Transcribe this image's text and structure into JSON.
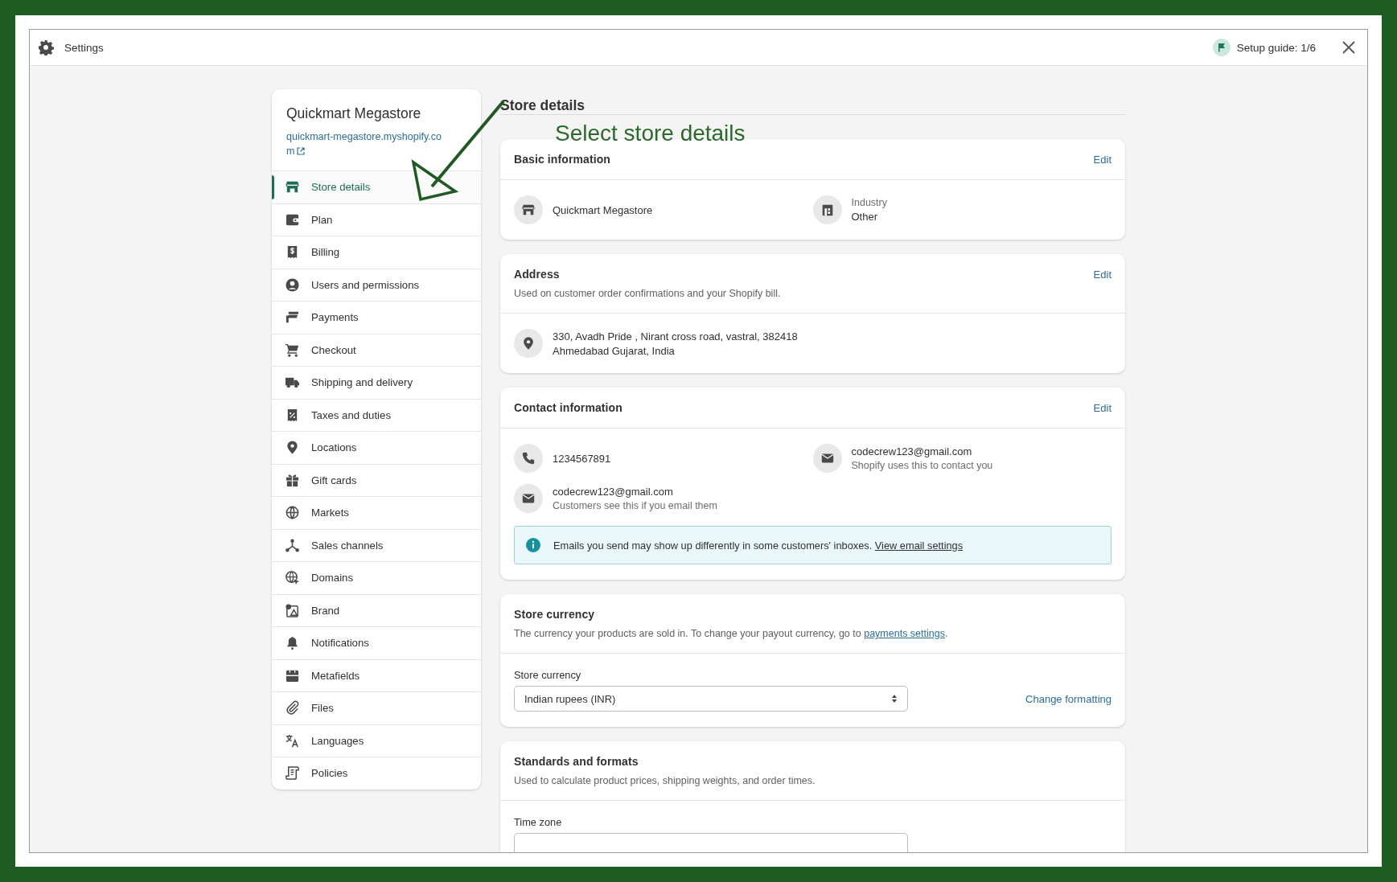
{
  "window": {
    "title": "Settings",
    "setup_guide": "Setup guide: 1/6"
  },
  "sidebar": {
    "store_name": "Quickmart Megastore",
    "store_url": "quickmart-megastore.myshopify.com",
    "items": [
      {
        "label": "Store details",
        "selected": true
      },
      {
        "label": "Plan",
        "selected": false
      },
      {
        "label": "Billing",
        "selected": false
      },
      {
        "label": "Users and permissions",
        "selected": false
      },
      {
        "label": "Payments",
        "selected": false
      },
      {
        "label": "Checkout",
        "selected": false
      },
      {
        "label": "Shipping and delivery",
        "selected": false
      },
      {
        "label": "Taxes and duties",
        "selected": false
      },
      {
        "label": "Locations",
        "selected": false
      },
      {
        "label": "Gift cards",
        "selected": false
      },
      {
        "label": "Markets",
        "selected": false
      },
      {
        "label": "Sales channels",
        "selected": false
      },
      {
        "label": "Domains",
        "selected": false
      },
      {
        "label": "Brand",
        "selected": false
      },
      {
        "label": "Notifications",
        "selected": false
      },
      {
        "label": "Metafields",
        "selected": false
      },
      {
        "label": "Files",
        "selected": false
      },
      {
        "label": "Languages",
        "selected": false
      },
      {
        "label": "Policies",
        "selected": false
      }
    ]
  },
  "page_title": "Store details",
  "annotation": {
    "text": "Select store details"
  },
  "sections": [
    {
      "kind": "basic",
      "title": "Basic information",
      "action": "Edit",
      "fields": [
        {
          "kind": "store",
          "value": "Quickmart Megastore"
        },
        {
          "kind": "industry",
          "label": "Industry",
          "value": "Other"
        }
      ]
    },
    {
      "kind": "address",
      "title": "Address",
      "action": "Edit",
      "description": "Used on customer order confirmations and your Shopify bill.",
      "lines": [
        "330, Avadh Pride , Nirant cross road, vastral, 382418",
        "Ahmedabad Gujarat, India"
      ]
    },
    {
      "kind": "contact",
      "title": "Contact information",
      "action": "Edit",
      "entries": [
        {
          "kind": "phone",
          "value": "1234567891"
        },
        {
          "kind": "email",
          "value": "codecrew123@gmail.com",
          "note": "Shopify uses this to contact you"
        },
        {
          "kind": "email",
          "value": "codecrew123@gmail.com",
          "note": "Customers see this if you email them"
        }
      ],
      "banner": {
        "text": "Emails you send may show up differently in some customers' inboxes.",
        "link": "View email settings"
      }
    },
    {
      "kind": "currency",
      "title": "Store currency",
      "description": "The currency your products are sold in. To change your payout currency, go to",
      "description_link": "payments settings",
      "description_end": ".",
      "field_label": "Store currency",
      "value": "Indian rupees (INR)",
      "link": "Change formatting"
    },
    {
      "kind": "standards",
      "title": "Standards and formats",
      "description": "Used to calculate product prices, shipping weights, and order times.",
      "field_label": "Time zone"
    }
  ]
}
